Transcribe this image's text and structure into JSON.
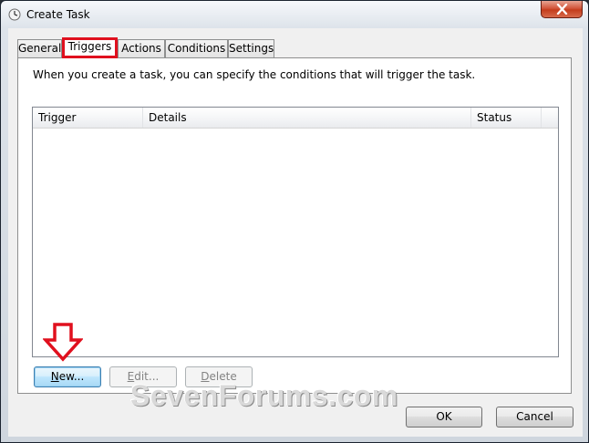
{
  "window": {
    "title": "Create Task",
    "close_icon": "close-icon",
    "title_icon": "task-scheduler-icon"
  },
  "tabs": [
    {
      "label": "General",
      "selected": false
    },
    {
      "label": "Triggers",
      "selected": true
    },
    {
      "label": "Actions",
      "selected": false
    },
    {
      "label": "Conditions",
      "selected": false
    },
    {
      "label": "Settings",
      "selected": false
    }
  ],
  "triggers_panel": {
    "description": "When you create a task, you can specify the conditions that will trigger the task.",
    "columns": [
      "Trigger",
      "Details",
      "Status"
    ],
    "rows": []
  },
  "buttons": {
    "new": {
      "underline": "N",
      "rest": "ew..."
    },
    "edit": {
      "underline": "E",
      "rest": "dit..."
    },
    "delete": {
      "underline": "D",
      "rest": "elete"
    },
    "ok": "OK",
    "cancel": "Cancel"
  },
  "annotation": {
    "highlight_color": "#e0101e",
    "arrow_icon": "down-arrow-icon"
  },
  "watermark": "SevenForums.com"
}
